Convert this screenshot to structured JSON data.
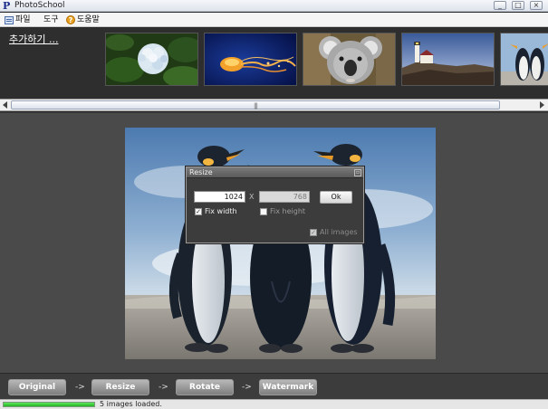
{
  "window": {
    "title": "PhotoSchool",
    "app_icon": "P",
    "controls": [
      "minimize",
      "maximize",
      "close"
    ]
  },
  "menu": {
    "file_label": "파일",
    "tools_label": "도구",
    "help_label": "도움말",
    "icons": [
      "file-icon",
      "help-icon"
    ]
  },
  "strip": {
    "add_label": "추가하기 ...",
    "thumbnails": [
      "hydrangea",
      "jellyfish",
      "koala",
      "lighthouse",
      "penguins"
    ]
  },
  "dialog": {
    "title": "Resize",
    "width_value": "1024",
    "height_value": "768",
    "separator": "X",
    "ok_label": "Ok",
    "fix_width_label": "Fix width",
    "fix_width_checked": true,
    "fix_height_label": "Fix height",
    "fix_height_checked": false,
    "all_images_label": "All images",
    "all_images_checked": true
  },
  "toolbar": {
    "original_label": "Original",
    "resize_label": "Resize",
    "rotate_label": "Rotate",
    "watermark_label": "Watermark",
    "arrow": "->"
  },
  "status": {
    "progress_fraction": 1.0,
    "text": "5 images loaded."
  },
  "colors": {
    "progress": "#22b522",
    "workspace": "#4a4a4a",
    "toolbar": "#3c3c3c"
  }
}
